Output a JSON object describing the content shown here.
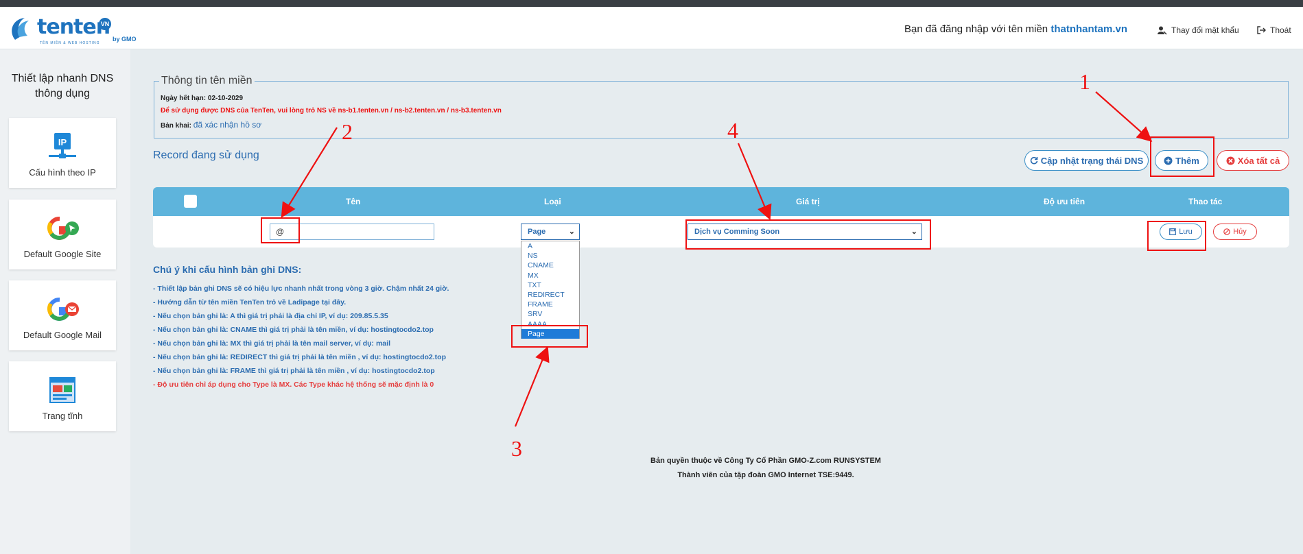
{
  "header": {
    "logo_text": "tenten",
    "logo_badge": "VN",
    "logo_gmo": "by GMO",
    "logo_sub": "TÊN MIỀN & WEB HOSTING",
    "login_prefix": "Bạn đã đăng nhập với tên miền",
    "login_domain": "thatnhantam.vn",
    "change_password": "Thay đổi mật khẩu",
    "logout": "Thoát"
  },
  "sidebar": {
    "title_line1": "Thiết lập nhanh DNS",
    "title_line2": "thông dụng",
    "items": [
      {
        "label": "Cấu hình theo IP",
        "icon": "ip-network-icon"
      },
      {
        "label": "Default Google Site",
        "icon": "google-site-icon"
      },
      {
        "label": "Default Google Mail",
        "icon": "google-mail-icon"
      },
      {
        "label": "Trang tĩnh",
        "icon": "static-page-icon"
      }
    ],
    "ip_glyph": "IP"
  },
  "domain_info": {
    "legend": "Thông tin tên miền",
    "expiry_label": "Ngày hết hạn:",
    "expiry_value": "02-10-2029",
    "ns_notice": "Để sử dụng được DNS của TenTen, vui lòng trỏ NS về ns-b1.tenten.vn / ns-b2.tenten.vn / ns-b3.tenten.vn",
    "declaration_label": "Bản khai:",
    "declaration_value": "đã xác nhận hồ sơ"
  },
  "records": {
    "title": "Record đang sử dụng",
    "update_button": "Cập nhật trạng thái DNS",
    "add_button": "Thêm",
    "delete_all_button": "Xóa tất cả",
    "columns": [
      "Tên",
      "Loại",
      "Giá trị",
      "Độ ưu tiên",
      "Thao tác"
    ],
    "row": {
      "name_value": "@",
      "type_value": "Page",
      "value_value": "Dịch vụ Comming Soon",
      "save_button": "Lưu",
      "cancel_button": "Hủy"
    },
    "type_options": [
      "A",
      "NS",
      "CNAME",
      "MX",
      "TXT",
      "REDIRECT",
      "FRAME",
      "SRV",
      "AAAA",
      "Page"
    ]
  },
  "notes": {
    "title": "Chú ý khi cấu hình bản ghi DNS:",
    "items": [
      "- Thiết lập bản ghi DNS sẽ có hiệu lực nhanh nhất trong vòng 3 giờ. Chậm nhất 24 giờ.",
      "- Hướng dẫn từ tên miền TenTen trỏ về Ladipage tại đây.",
      "- Nếu chọn bản ghi là: A thì giá trị phải là địa chỉ IP, ví dụ: 209.85.5.35",
      "- Nếu chọn bản ghi là: CNAME thì giá trị phải là tên miền, ví dụ: hostingtocdo2.top",
      "- Nếu chọn bản ghi là: MX thì giá trị phải là tên mail server, ví dụ: mail",
      "- Nếu chọn bản ghi là: REDIRECT thì giá trị phải là tên miền , ví dụ: hostingtocdo2.top",
      "- Nếu chọn bản ghi là: FRAME thì giá trị phải là tên miền , ví dụ: hostingtocdo2.top",
      "- Độ ưu tiên chỉ áp dụng cho Type là MX. Các Type khác hệ thống sẽ mặc định là 0"
    ]
  },
  "footer": {
    "line1": "Bản quyền thuộc về Công Ty Cổ Phần GMO-Z.com RUNSYSTEM",
    "line2": "Thành viên của tập đoàn GMO Internet TSE:9449."
  },
  "annotations": [
    "1",
    "2",
    "3",
    "4"
  ],
  "colors": {
    "primary": "#2b6cb0",
    "table_header": "#5eb4dc",
    "danger": "#e53e3e",
    "annotation": "#ee1111"
  }
}
